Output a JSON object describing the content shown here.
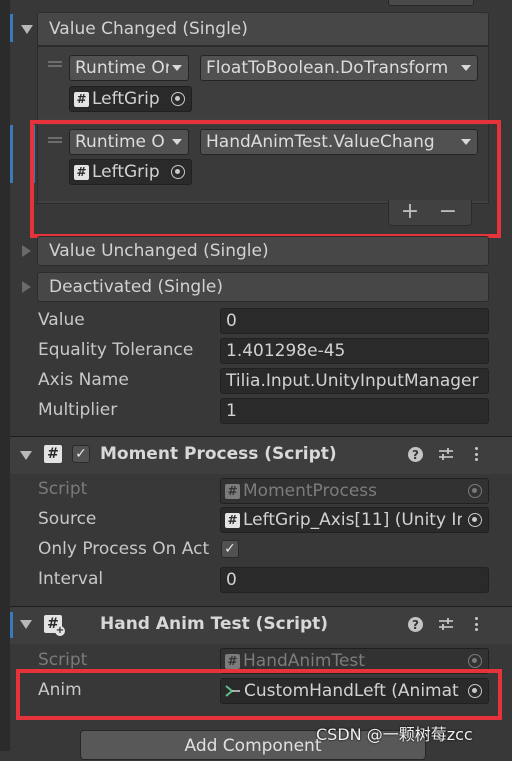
{
  "events": {
    "value_changed": {
      "title": "Value Changed (Single)",
      "items": [
        {
          "mode": "Runtime On",
          "function": "FloatToBoolean.DoTransform",
          "target": "LeftGrip"
        },
        {
          "mode": "Runtime O",
          "function": "HandAnimTest.ValueChang",
          "target": "LeftGrip"
        }
      ],
      "add_label": "+",
      "remove_label": "−"
    },
    "value_unchanged_title": "Value Unchanged (Single)",
    "deactivated_title": "Deactivated (Single)"
  },
  "input_fields": [
    {
      "label": "Value",
      "value": "0"
    },
    {
      "label": "Equality Tolerance",
      "value": "1.401298e-45"
    },
    {
      "label": "Axis Name",
      "value": "Tilia.Input.UnityInputManager"
    },
    {
      "label": "Multiplier",
      "value": "1"
    }
  ],
  "moment_process": {
    "title": "Moment Process (Script)",
    "enabled": true,
    "script_label": "Script",
    "script_value": "MomentProcess",
    "source_label": "Source",
    "source_value": "LeftGrip_Axis[11] (Unity In",
    "only_process_label": "Only Process On Act",
    "only_process_checked": true,
    "interval_label": "Interval",
    "interval_value": "0"
  },
  "hand_anim_test": {
    "title": "Hand Anim Test (Script)",
    "script_label": "Script",
    "script_value": "HandAnimTest",
    "anim_label": "Anim",
    "anim_value": "CustomHandLeft (Animat"
  },
  "add_component_label": "Add Component",
  "watermark": "CSDN @一颗树莓zcc",
  "icons": [
    "fold-arrow-icon",
    "script-icon",
    "object-picker-icon",
    "help-icon",
    "preset-sliders-icon",
    "more-options-icon",
    "animator-icon"
  ],
  "colors": {
    "highlight": "#e5323b",
    "accent": "#3a79bb"
  }
}
